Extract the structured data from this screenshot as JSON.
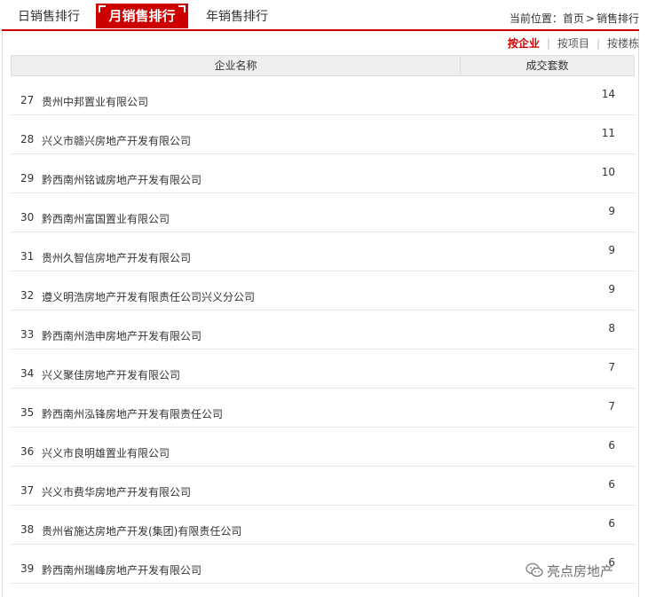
{
  "tabs": {
    "day": "日销售排行",
    "month": "月销售排行",
    "year": "年销售排行"
  },
  "breadcrumb": {
    "prefix": "当前位置：",
    "home": "首页",
    "separator": ">",
    "current": "销售排行"
  },
  "sort": {
    "by_company": "按企业",
    "by_project": "按项目",
    "by_building": "按楼栋"
  },
  "table": {
    "headers": {
      "name": "企业名称",
      "count": "成交套数"
    },
    "rows": [
      {
        "rank": "27",
        "company": "贵州中邦置业有限公司",
        "count": "14"
      },
      {
        "rank": "28",
        "company": "兴义市赣兴房地产开发有限公司",
        "count": "11"
      },
      {
        "rank": "29",
        "company": "黔西南州铭诚房地产开发有限公司",
        "count": "10"
      },
      {
        "rank": "30",
        "company": "黔西南州富国置业有限公司",
        "count": "9"
      },
      {
        "rank": "31",
        "company": "贵州久智信房地产开发有限公司",
        "count": "9"
      },
      {
        "rank": "32",
        "company": "遵义明浩房地产开发有限责任公司兴义分公司",
        "count": "9"
      },
      {
        "rank": "33",
        "company": "黔西南州浩申房地产开发有限公司",
        "count": "8"
      },
      {
        "rank": "34",
        "company": "兴义聚佳房地产开发有限公司",
        "count": "7"
      },
      {
        "rank": "35",
        "company": "黔西南州泓锋房地产开发有限责任公司",
        "count": "7"
      },
      {
        "rank": "36",
        "company": "兴义市良明雄置业有限公司",
        "count": "6"
      },
      {
        "rank": "37",
        "company": "兴义市费华房地产开发有限公司",
        "count": "6"
      },
      {
        "rank": "38",
        "company": "贵州省施达房地产开发(集团)有限责任公司",
        "count": "6"
      },
      {
        "rank": "39",
        "company": "黔西南州瑞峰房地产开发有限公司",
        "count": "6"
      }
    ]
  },
  "watermark": {
    "text": "亮点房地产",
    "icon": "wechat-icon"
  },
  "colors": {
    "accent": "#cc0000"
  }
}
